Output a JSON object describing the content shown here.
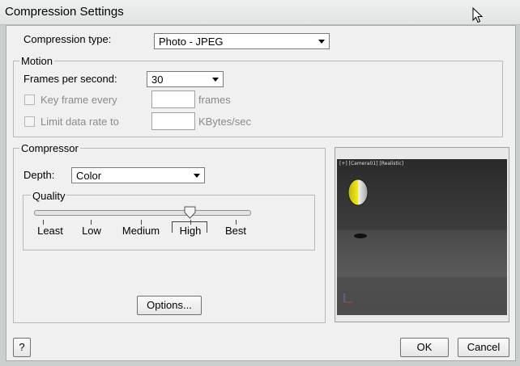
{
  "window": {
    "title": "Compression Settings"
  },
  "compression_type": {
    "label": "Compression type:",
    "value": "Photo - JPEG"
  },
  "motion": {
    "legend": "Motion",
    "fps_label": "Frames per second:",
    "fps_value": "30",
    "keyframe_label": "Key frame every",
    "keyframe_unit": "frames",
    "limit_label": "Limit data rate to",
    "limit_unit": "KBytes/sec"
  },
  "compressor": {
    "legend": "Compressor",
    "depth_label": "Depth:",
    "depth_value": "Color",
    "quality_legend": "Quality",
    "quality_levels": [
      "Least",
      "Low",
      "Medium",
      "High",
      "Best"
    ],
    "quality_selected": "High",
    "options_label": "Options..."
  },
  "preview": {
    "viewport_label": "[+] [Camera01] [Realistic]"
  },
  "buttons": {
    "help": "?",
    "ok": "OK",
    "cancel": "Cancel"
  }
}
